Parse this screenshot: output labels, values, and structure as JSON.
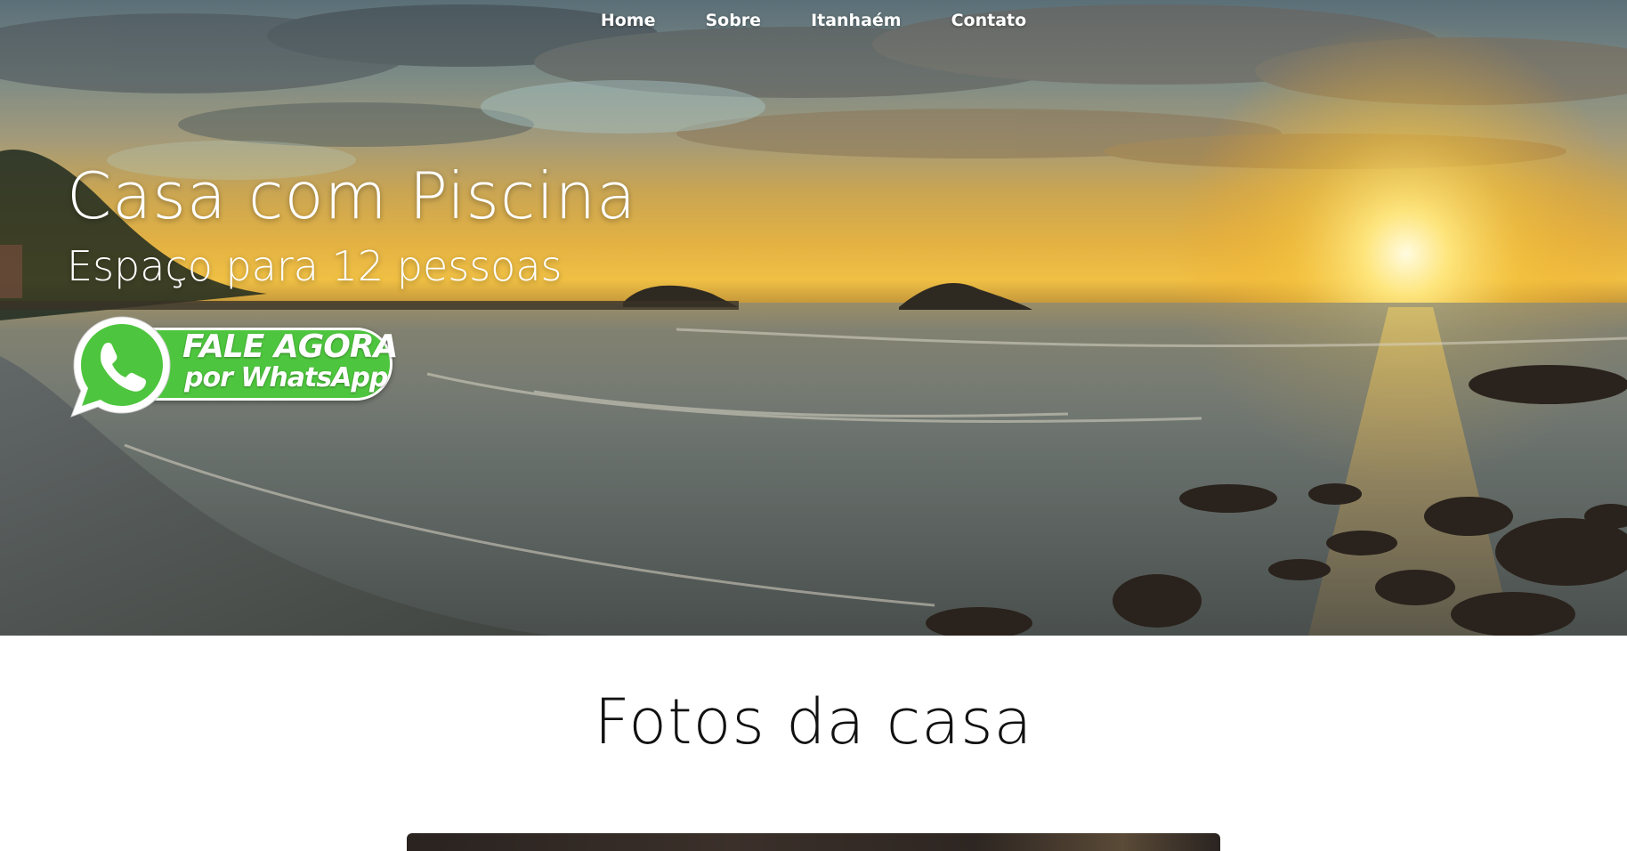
{
  "nav": {
    "items": [
      {
        "label": "Home"
      },
      {
        "label": "Sobre"
      },
      {
        "label": "Itanhaém"
      },
      {
        "label": "Contato"
      }
    ]
  },
  "hero": {
    "title": "Casa com Piscina",
    "subtitle": "Espaço para 12 pessoas",
    "cta": {
      "line1": "FALE AGORA",
      "line2": "por WhatsApp",
      "icon": "whatsapp-icon",
      "color": "#4ec53e"
    }
  },
  "gallery": {
    "title": "Fotos da casa"
  }
}
